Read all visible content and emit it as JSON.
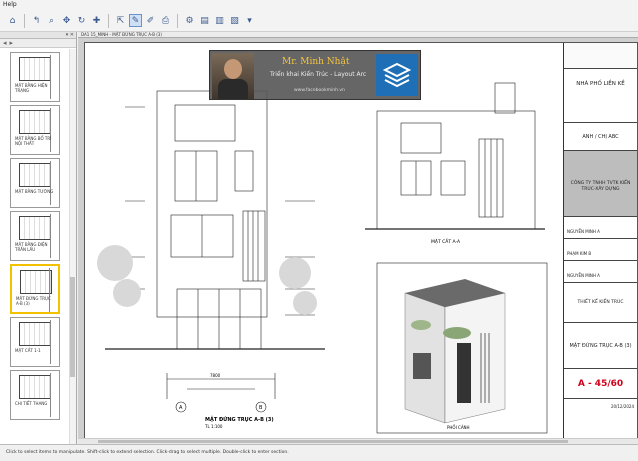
{
  "menu": {
    "help": "Help"
  },
  "toolbar": {
    "icons": [
      "nav-icon",
      "home-icon",
      "zoom-icon",
      "pan-icon",
      "redo-icon",
      "add-icon",
      "select-icon",
      "pencil-icon",
      "properties-icon",
      "print-icon",
      "doc-icon",
      "doc2-icon",
      "settings-icon",
      "arrow-icon"
    ]
  },
  "left_panel": {
    "thumbnails": [
      {
        "label": "MẶT BẰNG HIỆN TRẠNG"
      },
      {
        "label": "MẶT BẰNG BỐ TRÍ NỘI THẤT"
      },
      {
        "label": "MẶT BẰNG TƯỜNG"
      },
      {
        "label": "MẶT BẰNG ĐIỆN TRẦN LẦU"
      },
      {
        "label": "MẶT ĐỨNG TRỤC A-B (3)",
        "active": true
      },
      {
        "label": "MẶT CẮT 1-1"
      },
      {
        "label": "CHI TIẾT THANG"
      }
    ]
  },
  "tab": {
    "label": "DA1 15_MINH - MẶT ĐỨNG TRỤC A-B (3)"
  },
  "overlay": {
    "name": "Mr. Minh Nhật",
    "subtitle": "Triển khai Kiến Trúc - Layout Arc",
    "website": "www.facebookminh.vn"
  },
  "drawing": {
    "main_title": "MẶT ĐỨNG TRỤC A-B (3)",
    "main_scale": "TL 1:100",
    "side_title": "MẶT CẮT A-A",
    "perspective_title": "PHỐI CẢNH",
    "axis_a": "A",
    "axis_b": "B",
    "dim_total": "7800"
  },
  "title_block": {
    "client": "NHÀ PHỐ LIỀN KỀ",
    "owner": "ANH / CHỊ ABC",
    "company": "CÔNG TY TNHH TVTK KIẾN TRÚC-XÂY DỰNG",
    "director": "NGUYỄN MINH A",
    "designer": "PHẠM KIM B",
    "checker": "NGUYỄN MINH A",
    "category": "THIẾT KẾ KIẾN TRÚC",
    "sheet_name": "MẶT ĐỨNG TRỤC A-B (3)",
    "sheet_no": "A - 45/60",
    "date": "20/12/2024"
  },
  "status": {
    "text": "Click to select items to manipulate. Shift-click to extend selection. Click-drag to select multiple. Double-click to enter section."
  },
  "colors": {
    "accent": "#f2c200",
    "sheet_no": "#d0021b"
  }
}
